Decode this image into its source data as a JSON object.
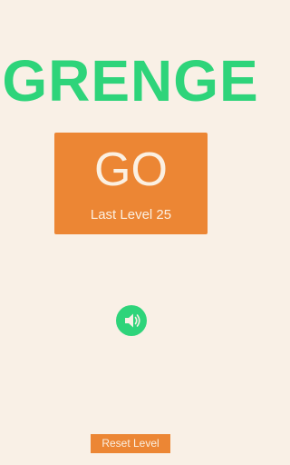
{
  "game": {
    "title": "GRENGE"
  },
  "go_button": {
    "label": "GO",
    "last_level_text": "Last Level 25"
  },
  "sound_button": {
    "icon": "speaker-icon",
    "state": "on"
  },
  "reset_button": {
    "label": "Reset Level"
  },
  "colors": {
    "background": "#f9f0e6",
    "accent_green": "#2ed47a",
    "accent_orange": "#ec8634",
    "button_text": "#fbf0e2"
  }
}
